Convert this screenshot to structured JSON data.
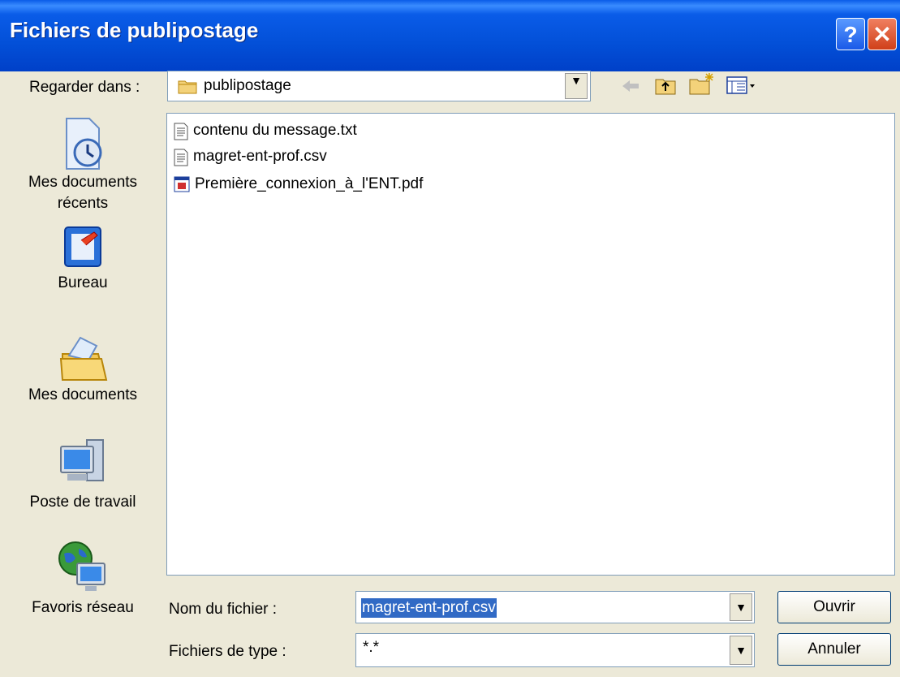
{
  "window": {
    "title": "Fichiers de publipostage",
    "help_label": "?",
    "close_label": "✕"
  },
  "lookin": {
    "label": "Regarder dans :",
    "value": "publipostage"
  },
  "places": [
    {
      "label1": "Mes documents",
      "label2": "récents"
    },
    {
      "label1": "Bureau"
    },
    {
      "label1": "Mes documents"
    },
    {
      "label1": "Poste de travail"
    },
    {
      "label1": "Favoris réseau"
    }
  ],
  "files": [
    "contenu du message.txt",
    "magret-ent-prof.csv",
    "Première_connexion_à_l'ENT.pdf"
  ],
  "filename": {
    "label": "Nom du fichier :",
    "value": "magret-ent-prof.csv"
  },
  "filetype": {
    "label": "Fichiers de type :",
    "value": "*.*"
  },
  "buttons": {
    "open": "Ouvrir",
    "cancel": "Annuler"
  },
  "colors": {
    "title_bar": "#0a5ce8",
    "selection": "#316ac5",
    "dialog": "#ece9d8"
  }
}
